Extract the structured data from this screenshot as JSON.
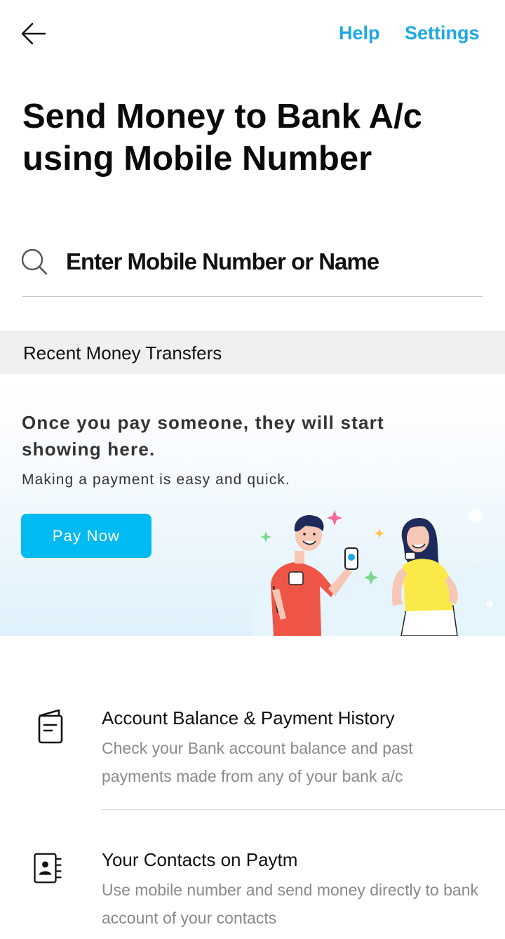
{
  "header": {
    "back_icon": "arrow-left-icon",
    "help_label": "Help",
    "settings_label": "Settings",
    "link_color": "#1ea7e4"
  },
  "page": {
    "title": "Send Money to Bank A/c\nusing Mobile Number"
  },
  "search": {
    "icon": "search-icon",
    "placeholder": "Enter Mobile Number or Name",
    "value": ""
  },
  "recent": {
    "section_title": "Recent Money Transfers",
    "empty_heading": "Once you pay someone, they will start\nshowing here.",
    "empty_subtext": "Making a payment is easy and quick.",
    "pay_now_label": "Pay Now",
    "button_color": "#00baf2"
  },
  "features": [
    {
      "icon": "passbook-icon",
      "title": "Account Balance & Payment History",
      "description": "Check your Bank account balance and past payments made from any of your bank a/c"
    },
    {
      "icon": "contacts-book-icon",
      "title": "Your Contacts on Paytm",
      "description": "Use mobile number and send money directly to bank account of your contacts"
    }
  ]
}
